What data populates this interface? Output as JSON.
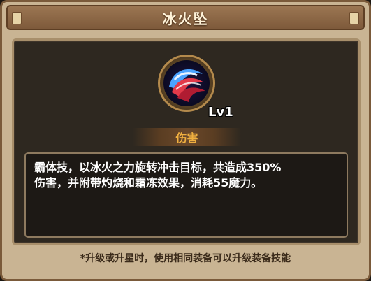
{
  "dialog": {
    "title": "冰火坠"
  },
  "skill": {
    "icon": "ice-fire-swirl-icon",
    "level": "Lv1",
    "tag": "伤害",
    "description_lines": [
      "霸体技，以冰火之力旋转冲击目标，共造成350%",
      "伤害，并附带灼烧和霜冻效果，消耗55魔力。"
    ]
  },
  "footer": {
    "note": "*升级或升星时，使用相同装备可以升级装备技能"
  },
  "colors": {
    "title_text": "#fff3d9",
    "tag_text": "#f0b040",
    "frame": "#c9b493",
    "panel_bg": "#2e2820"
  }
}
